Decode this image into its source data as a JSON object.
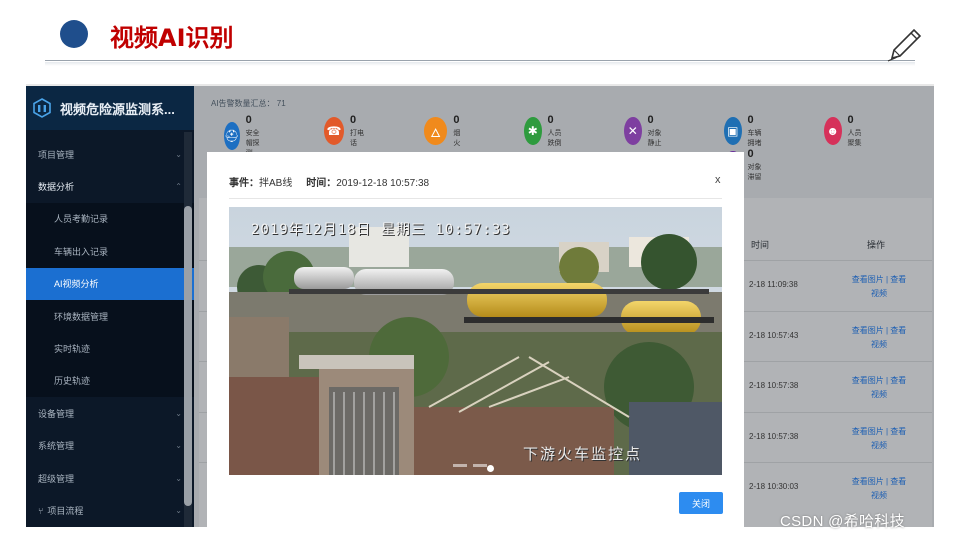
{
  "slide": {
    "title": "视频AI识别",
    "pen_icon": "pen-icon"
  },
  "app": {
    "brand": "视频危险源监测系..."
  },
  "sidebar": {
    "items": [
      {
        "label": "项目管理",
        "level": 1,
        "chevron": "⌄"
      },
      {
        "label": "数据分析",
        "level": 1,
        "chevron": "⌃",
        "open": true
      },
      {
        "label": "人员考勤记录",
        "level": 2
      },
      {
        "label": "车辆出入记录",
        "level": 2
      },
      {
        "label": "AI视频分析",
        "level": 2,
        "active": true
      },
      {
        "label": "环境数据管理",
        "level": 2
      },
      {
        "label": "实时轨迹",
        "level": 2
      },
      {
        "label": "历史轨迹",
        "level": 2
      },
      {
        "label": "设备管理",
        "level": 1,
        "chevron": "⌄"
      },
      {
        "label": "系统管理",
        "level": 1,
        "chevron": "⌄"
      },
      {
        "label": "超级管理",
        "level": 1,
        "chevron": "⌄"
      },
      {
        "label": "项目流程",
        "level": 1,
        "chevron": "⌄",
        "icon": "flow-icon"
      }
    ]
  },
  "alarms": {
    "summary": "AI告警数量汇总： 71",
    "items": [
      {
        "label": "安全帽探测",
        "count": "0",
        "color": "#1d6fc2",
        "icon": "helmet-icon"
      },
      {
        "label": "打电话",
        "count": "0",
        "color": "#e25a2a",
        "icon": "phone-icon"
      },
      {
        "label": "烟火",
        "count": "0",
        "color": "#f08a1c",
        "icon": "fire-icon"
      },
      {
        "label": "人员跌倒",
        "count": "0",
        "color": "#2e9b3e",
        "icon": "fall-icon"
      },
      {
        "label": "对象静止",
        "count": "0",
        "color": "#7e3fa0",
        "icon": "still-icon"
      },
      {
        "label": "车辆拥堵",
        "count": "0",
        "color": "#1f6fb3",
        "icon": "car-icon"
      },
      {
        "label": "人员聚集",
        "count": "0",
        "color": "#d6315a",
        "icon": "crowd-icon"
      },
      {
        "label": "对象滞留",
        "count": "0",
        "color": "#6a2f9c",
        "icon": "stay-icon"
      }
    ]
  },
  "table": {
    "time_header": "时间",
    "op_header": "操作",
    "rows": [
      {
        "time": "2-18 11:09:38",
        "op": "查看图片 | 查看视频"
      },
      {
        "time": "2-18 10:57:43",
        "op": "查看图片 | 查看视频"
      },
      {
        "time": "2-18 10:57:38",
        "op": "查看图片 | 查看视频"
      },
      {
        "time": "2-18 10:57:38",
        "op": "查看图片 | 查看视频"
      },
      {
        "time": "2-18 10:30:03",
        "op": "查看图片 | 查看视频"
      }
    ]
  },
  "modal": {
    "event_label": "事件：",
    "event_value": "拌AB线",
    "time_label": "时间：",
    "time_value": "2019-12-18 10:57:38",
    "close_x": "x",
    "close_button": "关闭",
    "video": {
      "timestamp": "2019年12月18日 星期三 10:57:33",
      "caption": "下游火车监控点"
    }
  },
  "watermark": "CSDN @希哈科技"
}
